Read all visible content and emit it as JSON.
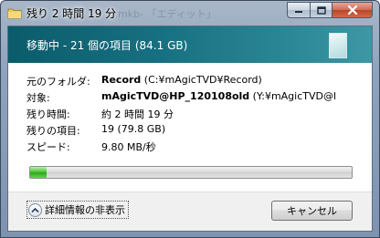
{
  "window": {
    "title": "残り 2 時間 19 分",
    "ghost_title": "mkb- 「エディット」",
    "controls": {
      "minimize": "minimize",
      "maximize": "maximize",
      "close": "close"
    }
  },
  "banner": {
    "text": "移動中 - 21 個の項目 (84.1 GB)"
  },
  "details": {
    "rows": [
      {
        "label": "元のフォルダ:",
        "value_bold": "Record",
        "value_rest": " (C:¥mAgicTVD¥Record)"
      },
      {
        "label": "対象:",
        "value_bold": "mAgicTVD@HP_120108old",
        "value_rest": " (Y:¥mAgicTVD@l"
      },
      {
        "label": "残り時間:",
        "value_bold": "",
        "value_rest": "約 2 時間 19 分"
      },
      {
        "label": "残りの項目:",
        "value_bold": "",
        "value_rest": "19 (79.8 GB)"
      },
      {
        "label": "スピード:",
        "value_bold": "",
        "value_rest": "9.80 MB/秒"
      }
    ]
  },
  "progress": {
    "fraction": 0.05,
    "color": "#2fa61c"
  },
  "footer": {
    "toggle_label": "詳細情報の非表示",
    "cancel_label": "キャンセル"
  }
}
